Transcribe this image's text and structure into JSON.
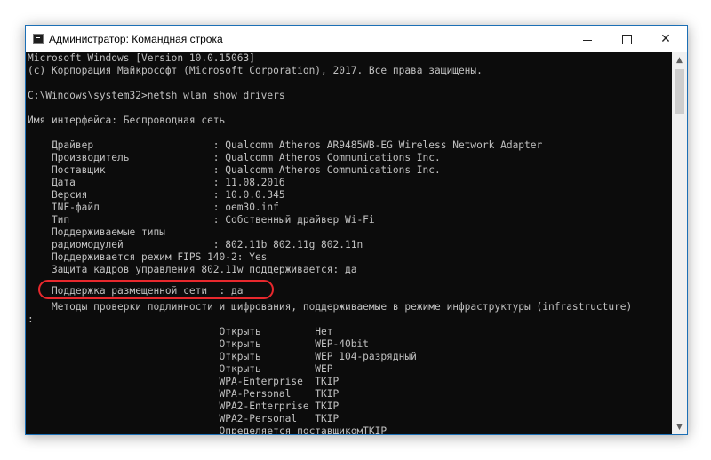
{
  "window": {
    "title": "Администратор: Командная строка",
    "controls": {
      "minimize": "minimize",
      "maximize": "maximize",
      "close": "close"
    }
  },
  "console": {
    "lines": [
      "Microsoft Windows [Version 10.0.15063]",
      "(c) Корпорация Майкрософт (Microsoft Corporation), 2017. Все права защищены.",
      "",
      "C:\\Windows\\system32>netsh wlan show drivers",
      "",
      "Имя интерфейса: Беспроводная сеть",
      "",
      "    Драйвер                    : Qualcomm Atheros AR9485WB-EG Wireless Network Adapter",
      "    Производитель              : Qualcomm Atheros Communications Inc.",
      "    Поставщик                  : Qualcomm Atheros Communications Inc.",
      "    Дата                       : 11.08.2016",
      "    Версия                     : 10.0.0.345",
      "    INF-файл                   : oem30.inf",
      "    Тип                        : Собственный драйвер Wi-Fi",
      "    Поддерживаемые типы",
      "    радиомодулей               : 802.11b 802.11g 802.11n",
      "    Поддерживается режим FIPS 140-2: Yes",
      "    Защита кадров управления 802.11w поддерживается: да",
      "    Поддержка размещенной сети  : да",
      "    Методы проверки подлинности и шифрования, поддерживаемые в режиме инфраструктуры (infrastructure)",
      ":",
      "                                Открыть         Нет",
      "                                Открыть         WEP-40bit",
      "                                Открыть         WEP 104-разрядный",
      "                                Открыть         WEP",
      "                                WPA-Enterprise  TKIP",
      "                                WPA-Personal    TKIP",
      "                                WPA2-Enterprise TKIP",
      "                                WPA2-Personal   TKIP",
      "                                Определяется поставщикомTKIP"
    ]
  },
  "annotation": {
    "highlighted_line": "Поддержка размещенной сети  : да",
    "color": "#e8282d"
  },
  "colors": {
    "console_bg": "#0c0c0c",
    "console_text": "#c0c0c0",
    "titlebar_bg": "#ffffff"
  }
}
